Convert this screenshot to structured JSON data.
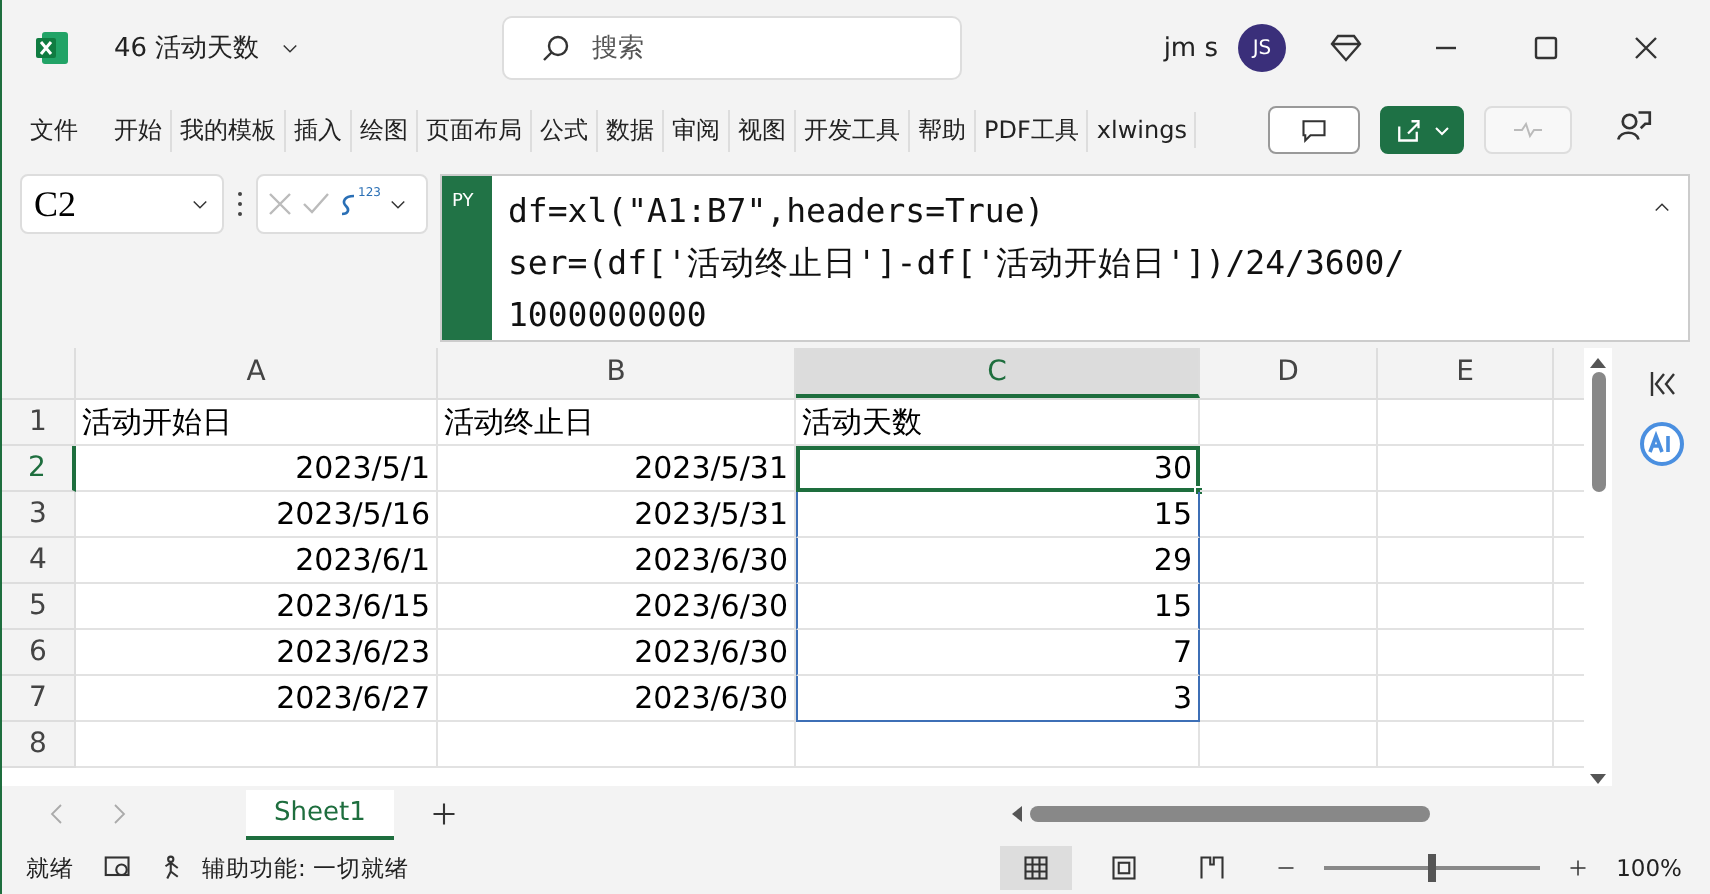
{
  "window": {
    "file_name": "46 活动天数",
    "search_placeholder": "搜索",
    "user_name": "jm s",
    "avatar_initials": "JS"
  },
  "ribbon_tabs": [
    {
      "label": "文件",
      "selected": false
    },
    {
      "label": "开始",
      "selected": false
    },
    {
      "label": "我的模板",
      "selected": false
    },
    {
      "label": "插入",
      "selected": false
    },
    {
      "label": "绘图",
      "selected": false
    },
    {
      "label": "页面布局",
      "selected": false
    },
    {
      "label": "公式",
      "selected": false
    },
    {
      "label": "数据",
      "selected": false
    },
    {
      "label": "审阅",
      "selected": false
    },
    {
      "label": "视图",
      "selected": false
    },
    {
      "label": "开发工具",
      "selected": false
    },
    {
      "label": "帮助",
      "selected": false
    },
    {
      "label": "PDF工具",
      "selected": false
    },
    {
      "label": "xlwings",
      "selected": false
    }
  ],
  "formula_bar": {
    "name_box": "C2",
    "mode_label": "123",
    "py_badge": "PY",
    "lines": [
      "df=xl(\"A1:B7\",headers=True)",
      "ser=(df['活动终止日']-df['活动开始日'])/24/3600/",
      "1000000000"
    ]
  },
  "columns": [
    {
      "label": "A",
      "selected": false
    },
    {
      "label": "B",
      "selected": false
    },
    {
      "label": "C",
      "selected": true
    },
    {
      "label": "D",
      "selected": false
    },
    {
      "label": "E",
      "selected": false
    }
  ],
  "rows": [
    {
      "number": "1",
      "selected": false,
      "cells": [
        {
          "value": "活动开始日",
          "kind": "text",
          "in_range": false,
          "active": false
        },
        {
          "value": "活动终止日",
          "kind": "text",
          "in_range": false,
          "active": false
        },
        {
          "value": "活动天数",
          "kind": "text",
          "in_range": false,
          "active": false
        }
      ]
    },
    {
      "number": "2",
      "selected": true,
      "cells": [
        {
          "value": "2023/5/1",
          "kind": "number",
          "in_range": false,
          "active": false
        },
        {
          "value": "2023/5/31",
          "kind": "number",
          "in_range": false,
          "active": false
        },
        {
          "value": "30",
          "kind": "number",
          "in_range": true,
          "active": true
        }
      ]
    },
    {
      "number": "3",
      "selected": false,
      "cells": [
        {
          "value": "2023/5/16",
          "kind": "number",
          "in_range": false,
          "active": false
        },
        {
          "value": "2023/5/31",
          "kind": "number",
          "in_range": false,
          "active": false
        },
        {
          "value": "15",
          "kind": "number",
          "in_range": true,
          "active": false
        }
      ]
    },
    {
      "number": "4",
      "selected": false,
      "cells": [
        {
          "value": "2023/6/1",
          "kind": "number",
          "in_range": false,
          "active": false
        },
        {
          "value": "2023/6/30",
          "kind": "number",
          "in_range": false,
          "active": false
        },
        {
          "value": "29",
          "kind": "number",
          "in_range": true,
          "active": false
        }
      ]
    },
    {
      "number": "5",
      "selected": false,
      "cells": [
        {
          "value": "2023/6/15",
          "kind": "number",
          "in_range": false,
          "active": false
        },
        {
          "value": "2023/6/30",
          "kind": "number",
          "in_range": false,
          "active": false
        },
        {
          "value": "15",
          "kind": "number",
          "in_range": true,
          "active": false
        }
      ]
    },
    {
      "number": "6",
      "selected": false,
      "cells": [
        {
          "value": "2023/6/23",
          "kind": "number",
          "in_range": false,
          "active": false
        },
        {
          "value": "2023/6/30",
          "kind": "number",
          "in_range": false,
          "active": false
        },
        {
          "value": "7",
          "kind": "number",
          "in_range": true,
          "active": false
        }
      ]
    },
    {
      "number": "7",
      "selected": false,
      "cells": [
        {
          "value": "2023/6/27",
          "kind": "number",
          "in_range": false,
          "active": false
        },
        {
          "value": "2023/6/30",
          "kind": "number",
          "in_range": false,
          "active": false
        },
        {
          "value": "3",
          "kind": "number",
          "in_range": true,
          "active": false
        }
      ]
    },
    {
      "number": "8",
      "selected": false,
      "cells": []
    }
  ],
  "sheet_tabs": [
    {
      "label": "Sheet1",
      "selected": true
    }
  ],
  "status_bar": {
    "ready": "就绪",
    "accessibility": "辅助功能: 一切就绪",
    "zoom": "100%",
    "zoom_level": {
      "level": 0.5
    }
  }
}
